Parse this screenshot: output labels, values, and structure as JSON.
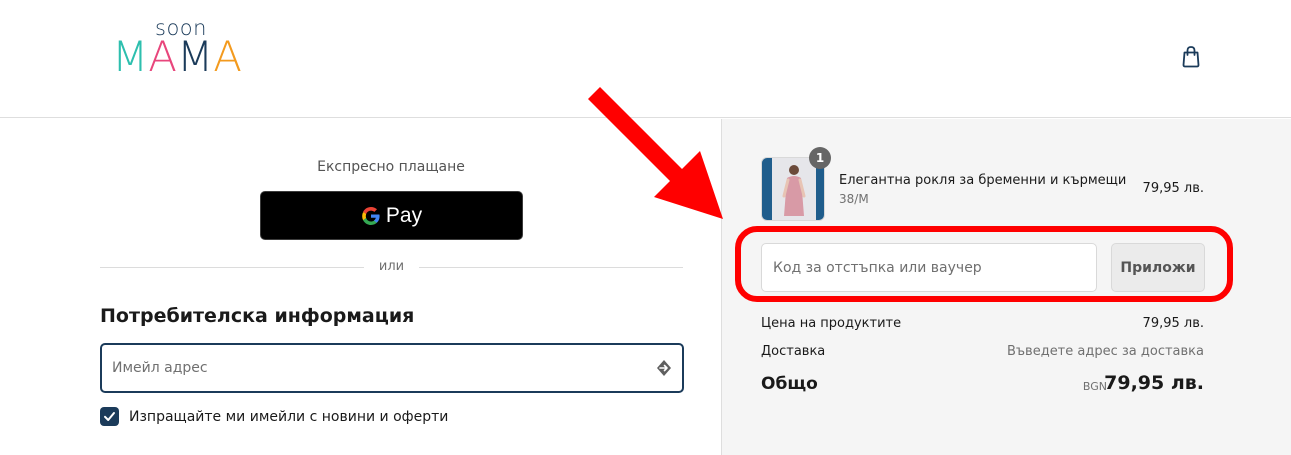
{
  "brand": {
    "logo_top": "soon",
    "logo_main_letters": [
      "M",
      "A",
      "M",
      "A"
    ],
    "logo_colors": [
      "#2dbfae",
      "#e8467c",
      "#1b3b5a",
      "#f39a1e"
    ]
  },
  "header": {
    "cart_icon": "shopping-bag-icon"
  },
  "express": {
    "title": "Експресно плащане",
    "gpay_label": "Pay"
  },
  "divider": {
    "text": "или"
  },
  "customer": {
    "title": "Потребителска информация",
    "email_placeholder": "Имейл адрес",
    "email_value": "",
    "newsletter_label": "Изпращайте ми имейли с новини и оферти",
    "newsletter_checked": true
  },
  "cart": {
    "item": {
      "quantity": "1",
      "name": "Елегантна рокля за бременни и кърмещи",
      "variant": "38/M",
      "price": "79,95 лв."
    },
    "discount": {
      "placeholder": "Код за отстъпка или ваучер",
      "apply_label": "Приложи"
    },
    "summary": {
      "subtotal_label": "Цена на продуктите",
      "subtotal_value": "79,95 лв.",
      "shipping_label": "Доставка",
      "shipping_value": "Въведете адрес за доставка",
      "total_label": "Общо",
      "total_currency": "BGN",
      "total_value": "79,95 лв."
    }
  },
  "colors": {
    "accent": "#1b3b5a",
    "annotation": "#ff0000",
    "sidebar_bg": "#f5f5f5"
  }
}
